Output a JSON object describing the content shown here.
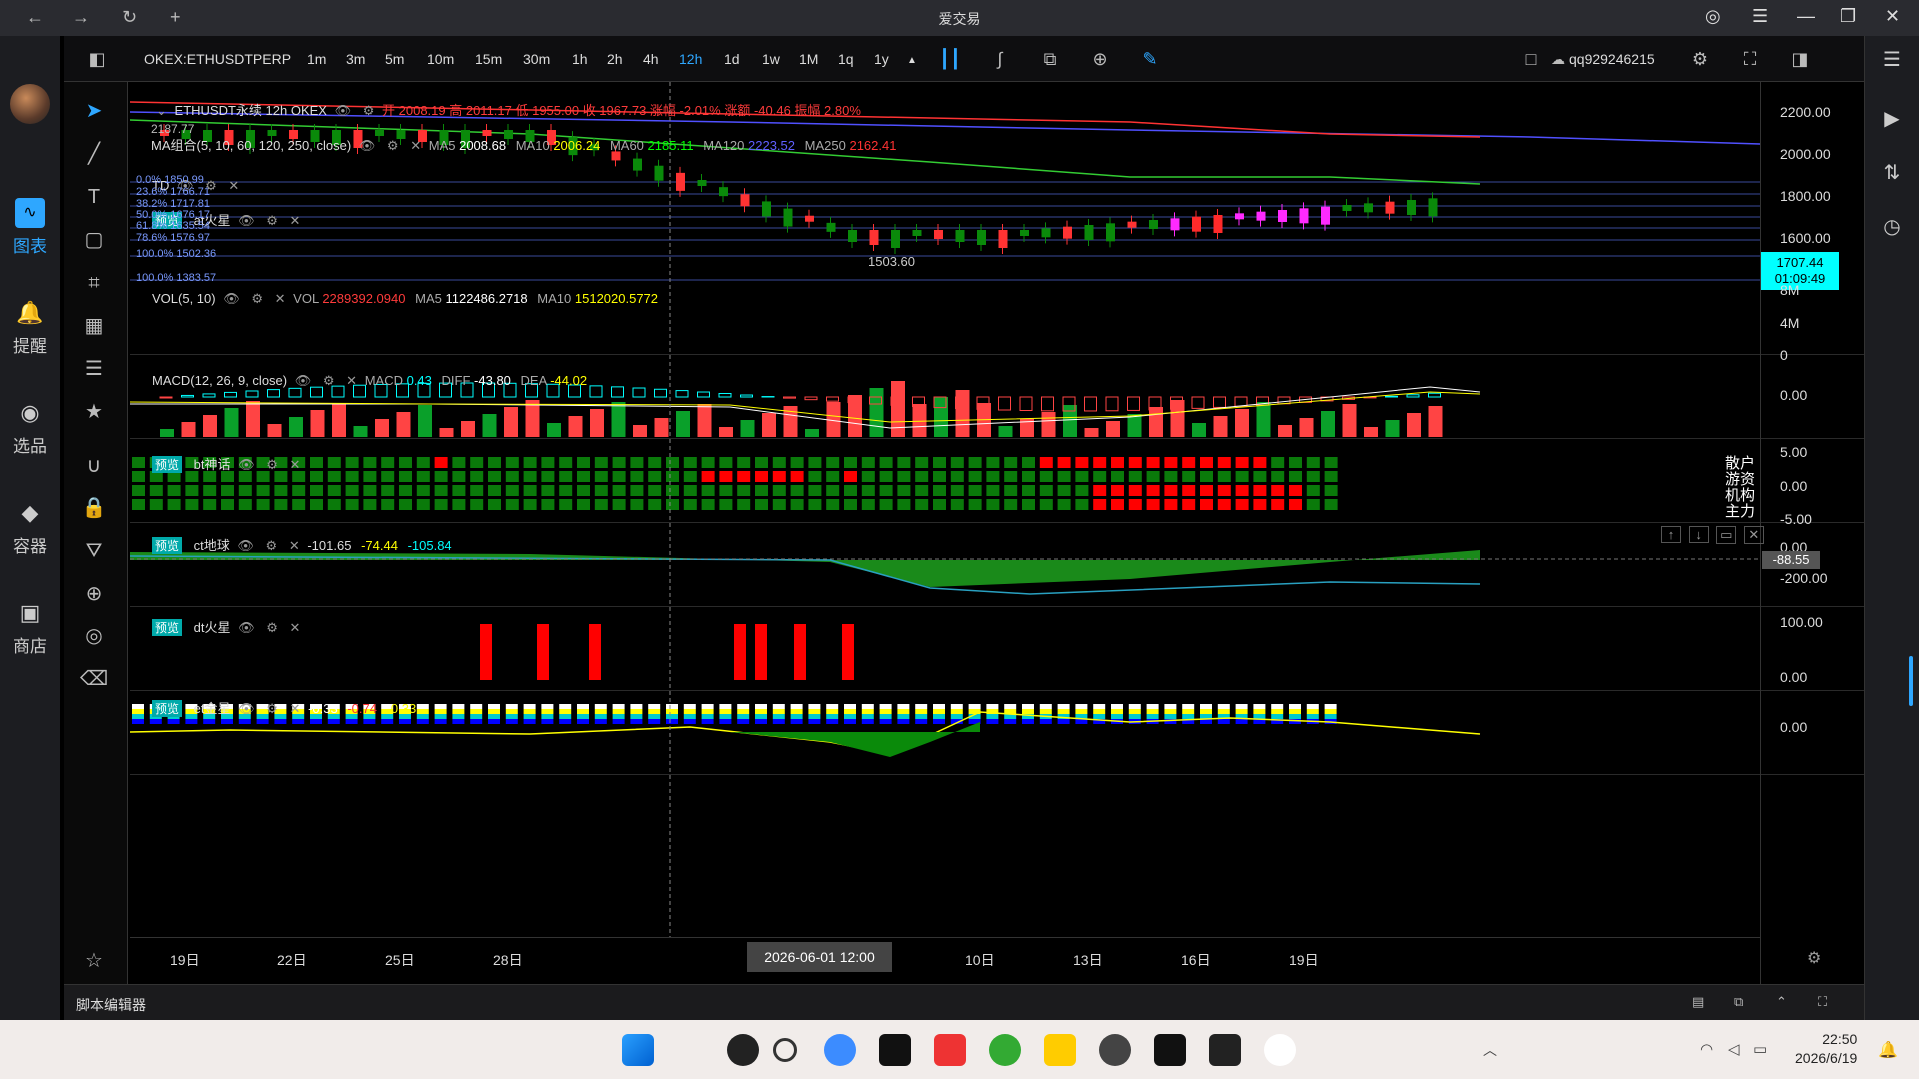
{
  "window": {
    "title": "爱交易"
  },
  "left_nav": {
    "items": [
      {
        "label": "图表",
        "icon": "chart-icon",
        "active": true
      },
      {
        "label": "提醒",
        "icon": "bell-icon"
      },
      {
        "label": "选品",
        "icon": "search-chart-icon"
      },
      {
        "label": "容器",
        "icon": "container-icon"
      },
      {
        "label": "商店",
        "icon": "store-icon"
      }
    ]
  },
  "toolbar": {
    "symbol": "OKEX:ETHUSDTPERP",
    "timeframes": [
      "1m",
      "3m",
      "5m",
      "10m",
      "15m",
      "30m",
      "1h",
      "2h",
      "4h",
      "12h",
      "1d",
      "1w",
      "1M",
      "1q",
      "1y"
    ],
    "active_timeframe": "12h",
    "account": "qq929246215"
  },
  "chart": {
    "header": {
      "name": "ETHUSDT永续 12h OKEX",
      "ohlc_text": "开 2008.19 高 2011.17 低 1955.00 收 1967.73 涨幅 -2.01% 涨额 -40.46 振幅 2.80%"
    },
    "ma": {
      "label": "MA组合(5, 10, 60, 120, 250, close)",
      "items": [
        {
          "name": "MA5",
          "value": "2008.68",
          "color": "#ffffff"
        },
        {
          "name": "MA10",
          "value": "2006.24",
          "color": "#ffff00"
        },
        {
          "name": "MA60",
          "value": "2185.11",
          "color": "#00ff00"
        },
        {
          "name": "MA120",
          "value": "2223.52",
          "color": "#6060ff"
        },
        {
          "name": "MA250",
          "value": "2162.41",
          "color": "#ff3333"
        }
      ]
    },
    "td_label": "TD",
    "at_label": "at火星",
    "badge": "预览",
    "fib_levels": [
      {
        "label": "0.0% 1850.99"
      },
      {
        "label": "23.6% 1766.71"
      },
      {
        "label": "38.2% 1717.81"
      },
      {
        "label": "50.0% 1676.17"
      },
      {
        "label": "61.8% 1635.54"
      },
      {
        "label": "78.6% 1576.97"
      },
      {
        "label": "100.0% 1502.36"
      },
      {
        "label": "100.0% 1383.57"
      }
    ],
    "high_label": "2187.77",
    "low_label": "1503.60",
    "price_axis": [
      "2200.00",
      "2000.00",
      "1800.00",
      "1600.00"
    ],
    "current_price": "1707.44",
    "countdown": "01:09:49",
    "vol": {
      "label": "VOL(5, 10)",
      "vol": "2289392.0940",
      "ma5": "1122486.2718",
      "ma10": "1512020.5772",
      "axis": [
        "8M",
        "4M",
        "0"
      ]
    },
    "macd": {
      "label": "MACD(12, 26, 9, close)",
      "macd": "0.43",
      "diff": "-43.80",
      "dea": "-44.02",
      "axis": [
        "0.00"
      ]
    },
    "bt": {
      "label": "bt神话",
      "axis": [
        "5.00",
        "0.00",
        "-5.00"
      ],
      "legend": [
        "散户",
        "游资",
        "机构",
        "主力"
      ]
    },
    "ct": {
      "label": "ct地球",
      "v1": "-101.65",
      "v2": "-74.44",
      "v3": "-105.84",
      "axis": [
        "0.00",
        "-200.00"
      ],
      "crosshair_value": "-88.55"
    },
    "dt": {
      "label": "dt火星",
      "axis": [
        "100.00",
        "0.00"
      ]
    },
    "et": {
      "label": "et金星",
      "v1": "-0.33",
      "v2": "-0.74",
      "v3": "-0.33",
      "axis": [
        "0.00"
      ]
    },
    "x_axis": [
      "19日",
      "22日",
      "25日",
      "28日",
      "4日",
      "7日",
      "10日",
      "13日",
      "16日",
      "19日"
    ],
    "crosshair_date": "2026-06-01  12:00"
  },
  "bottom_bar": {
    "label": "脚本编辑器"
  },
  "taskbar": {
    "time": "22:50",
    "date": "2026/6/19"
  }
}
